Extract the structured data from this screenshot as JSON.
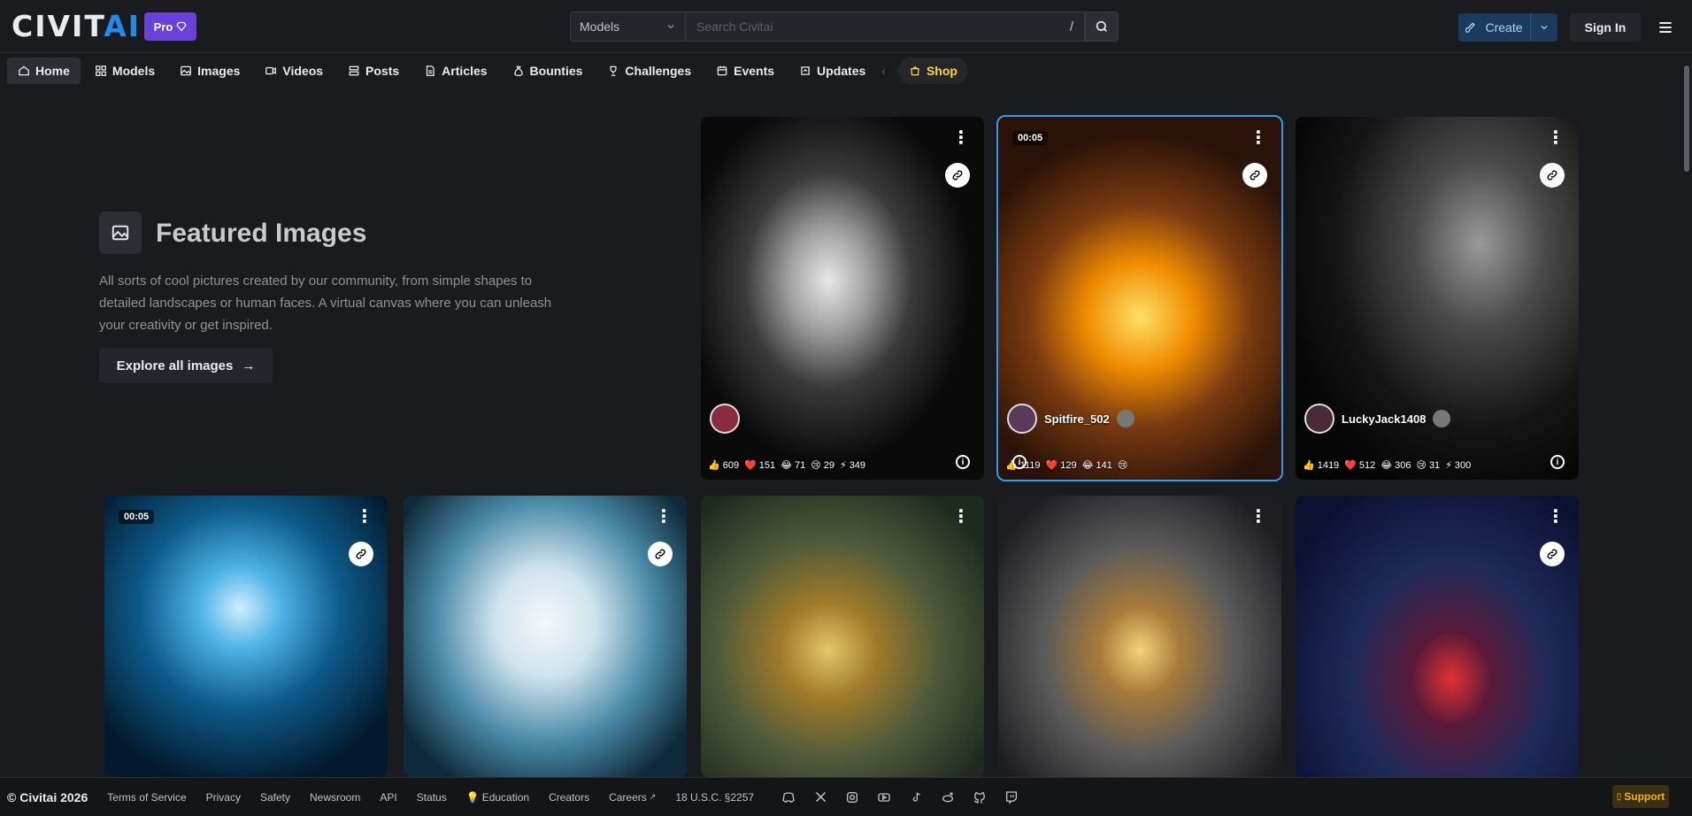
{
  "header": {
    "logo_main": "CIVIT",
    "logo_accent": "AI",
    "pro_label": "Pro",
    "search_type": "Models",
    "search_placeholder": "Search Civitai",
    "search_hotkey": "/",
    "create_label": "Create",
    "signin_label": "Sign In"
  },
  "nav": {
    "items": [
      {
        "label": "Home",
        "icon": "home-icon"
      },
      {
        "label": "Models",
        "icon": "grid-icon"
      },
      {
        "label": "Images",
        "icon": "image-icon"
      },
      {
        "label": "Videos",
        "icon": "video-icon"
      },
      {
        "label": "Posts",
        "icon": "posts-icon"
      },
      {
        "label": "Articles",
        "icon": "article-icon"
      },
      {
        "label": "Bounties",
        "icon": "moneybag-icon"
      },
      {
        "label": "Challenges",
        "icon": "trophy-icon"
      },
      {
        "label": "Events",
        "icon": "calendar-icon"
      },
      {
        "label": "Updates",
        "icon": "updates-icon"
      }
    ],
    "shop_label": "Shop",
    "active": "Home"
  },
  "featured": {
    "title": "Featured Images",
    "description": "All sorts of cool pictures created by our community, from simple shapes to detailed landscapes or human faces. A virtual canvas where you can unleash your creativity or get inspired.",
    "explore_label": "Explore all images",
    "explore_arrow": "→"
  },
  "cards": [
    {
      "user": "",
      "duration": "",
      "reactions": [
        "609",
        "151",
        "71",
        "29",
        "349"
      ]
    },
    {
      "user": "Spitfire_502",
      "duration": "00:05",
      "reactions": [
        "1119",
        "129",
        "141",
        ""
      ]
    },
    {
      "user": "LuckyJack1408",
      "duration": "",
      "reactions": [
        "1419",
        "512",
        "306",
        "31",
        "300"
      ]
    },
    {
      "user": "",
      "duration": "00:05",
      "reactions": []
    },
    {
      "user": "",
      "duration": "",
      "reactions": []
    },
    {
      "user": "",
      "duration": "",
      "reactions": []
    },
    {
      "user": "",
      "duration": "",
      "reactions": []
    },
    {
      "user": "",
      "duration": "",
      "reactions": []
    }
  ],
  "footer": {
    "copyright": "© Civitai 2026",
    "links": [
      "Terms of Service",
      "Privacy",
      "Safety",
      "Newsroom",
      "API",
      "Status",
      "Education",
      "Creators",
      "Careers",
      "18 U.S.C. §2257"
    ],
    "support_label": "Support",
    "social_icons": [
      "discord-icon",
      "x-icon",
      "instagram-icon",
      "youtube-icon",
      "tiktok-icon",
      "reddit-icon",
      "github-icon",
      "twitch-icon"
    ]
  },
  "colors": {
    "background": "#1a1b1e",
    "accent": "#228be6",
    "pro": "#6741d9",
    "shop": "#ffd43b",
    "selected_outline": "#339af0"
  }
}
